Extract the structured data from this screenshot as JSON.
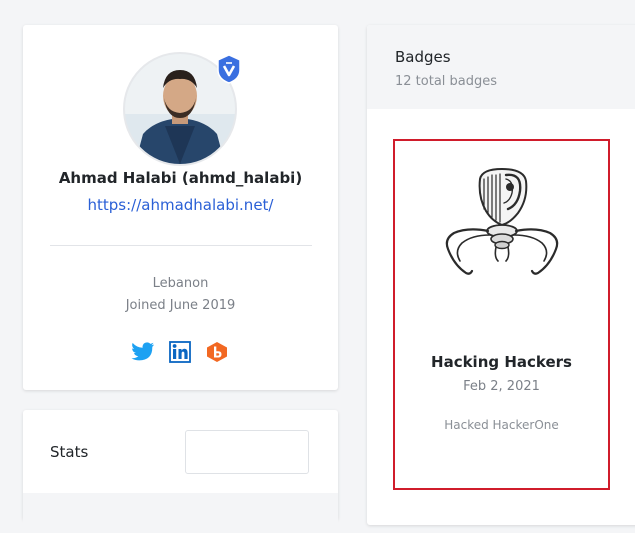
{
  "profile": {
    "name": "Ahmad Halabi (ahmd_halabi)",
    "website": "https://ahmadhalabi.net/",
    "location": "Lebanon",
    "joined": "Joined June 2019",
    "avatar_icon": "user-avatar-photo",
    "verified_icon": "verified-badge-icon",
    "socials": [
      {
        "icon": "twitter-icon",
        "color": "#1da1f2"
      },
      {
        "icon": "linkedin-icon",
        "color": "#0a66c2"
      },
      {
        "icon": "bugcrowd-icon",
        "color": "#f26822"
      }
    ]
  },
  "stats": {
    "title": "Stats",
    "selected_period": ""
  },
  "badges": {
    "title": "Badges",
    "count_text": "12 total badges",
    "items": [
      {
        "title": "Hacking Hackers",
        "date": "Feb 2, 2021",
        "description": "Hacked HackerOne",
        "icon": "spider-badge-icon",
        "highlight_color": "#d01c2b"
      }
    ]
  }
}
